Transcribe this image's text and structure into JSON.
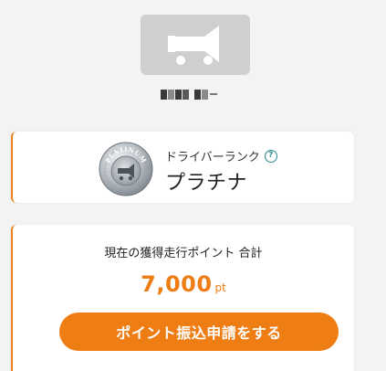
{
  "profile": {
    "avatar_icon": "truck-megaphone-icon",
    "username_masked": "■■ ■ー"
  },
  "rank": {
    "badge_icon": "platinum-badge-icon",
    "badge_text": "PLATINUM",
    "caption": "ドライバーランク",
    "help_icon": "question-circle-icon",
    "help_glyph": "?",
    "name": "プラチナ"
  },
  "points": {
    "label": "現在の獲得走行ポイント 合計",
    "value": "7,000",
    "unit": "pt",
    "transfer_button_label": "ポイント振込申請をする"
  },
  "colors": {
    "accent": "#ee7d14",
    "card_border": "#ee8020",
    "help_teal": "#2a8a8c",
    "background": "#f3f3f3",
    "avatar_bg": "#cfcfcf"
  }
}
